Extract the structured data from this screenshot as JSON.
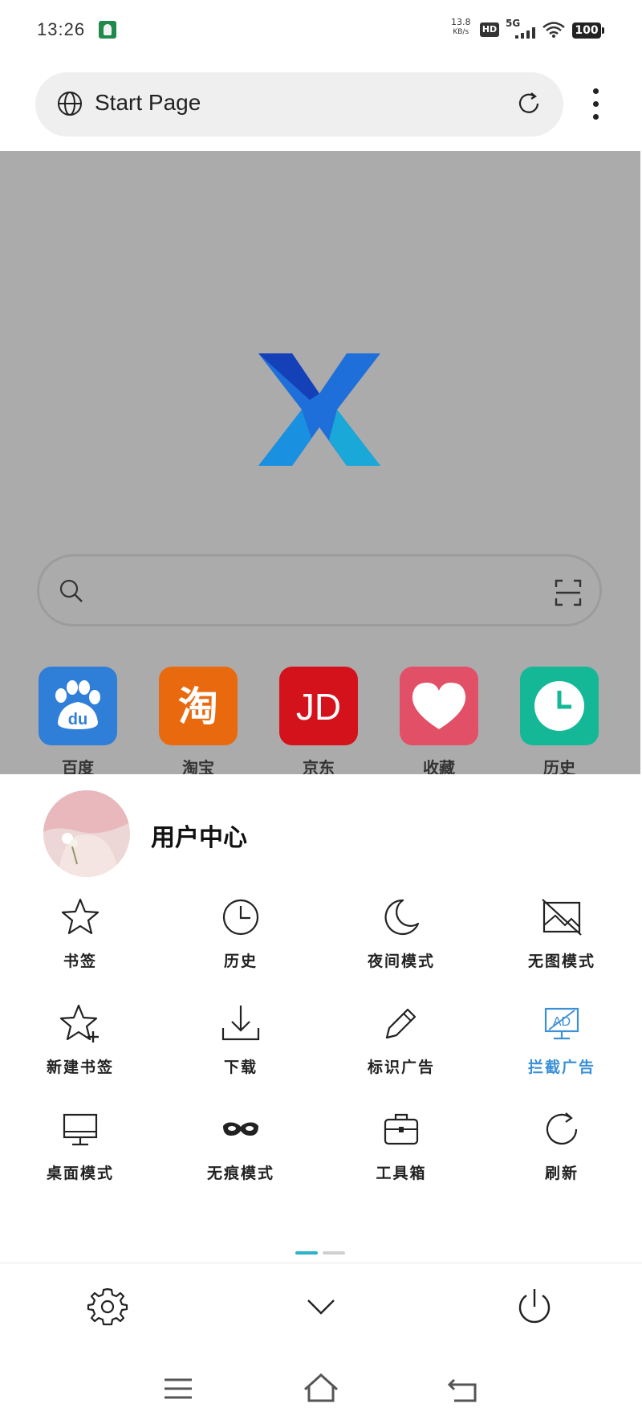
{
  "status": {
    "time": "13:26",
    "speed_value": "13.8",
    "speed_unit": "KB/s",
    "hd": "HD",
    "network": "5G",
    "battery": "100"
  },
  "address_bar": {
    "title": "Start Page"
  },
  "start_page": {
    "search_placeholder": "",
    "shortcuts": [
      {
        "label": "百度",
        "color": "#2f7ed8"
      },
      {
        "label": "淘宝",
        "color": "#e96a0e"
      },
      {
        "label": "京东",
        "color": "#d4121b"
      },
      {
        "label": "收藏",
        "color": "#e25068"
      },
      {
        "label": "历史",
        "color": "#15b896"
      }
    ]
  },
  "menu": {
    "user_label": "用户中心",
    "items": [
      {
        "label": "书签",
        "icon": "star-icon"
      },
      {
        "label": "历史",
        "icon": "clock-icon"
      },
      {
        "label": "夜间模式",
        "icon": "moon-icon"
      },
      {
        "label": "无图模式",
        "icon": "no-image-icon"
      },
      {
        "label": "新建书签",
        "icon": "star-plus-icon"
      },
      {
        "label": "下载",
        "icon": "download-icon"
      },
      {
        "label": "标识广告",
        "icon": "pencil-icon"
      },
      {
        "label": "拦截广告",
        "icon": "ad-block-icon",
        "active": true
      },
      {
        "label": "桌面模式",
        "icon": "monitor-icon"
      },
      {
        "label": "无痕模式",
        "icon": "mask-icon"
      },
      {
        "label": "工具箱",
        "icon": "toolbox-icon"
      },
      {
        "label": "刷新",
        "icon": "refresh-icon"
      }
    ],
    "active_color": "#3a8fd6",
    "pager": {
      "pages": 2,
      "current": 1
    }
  }
}
